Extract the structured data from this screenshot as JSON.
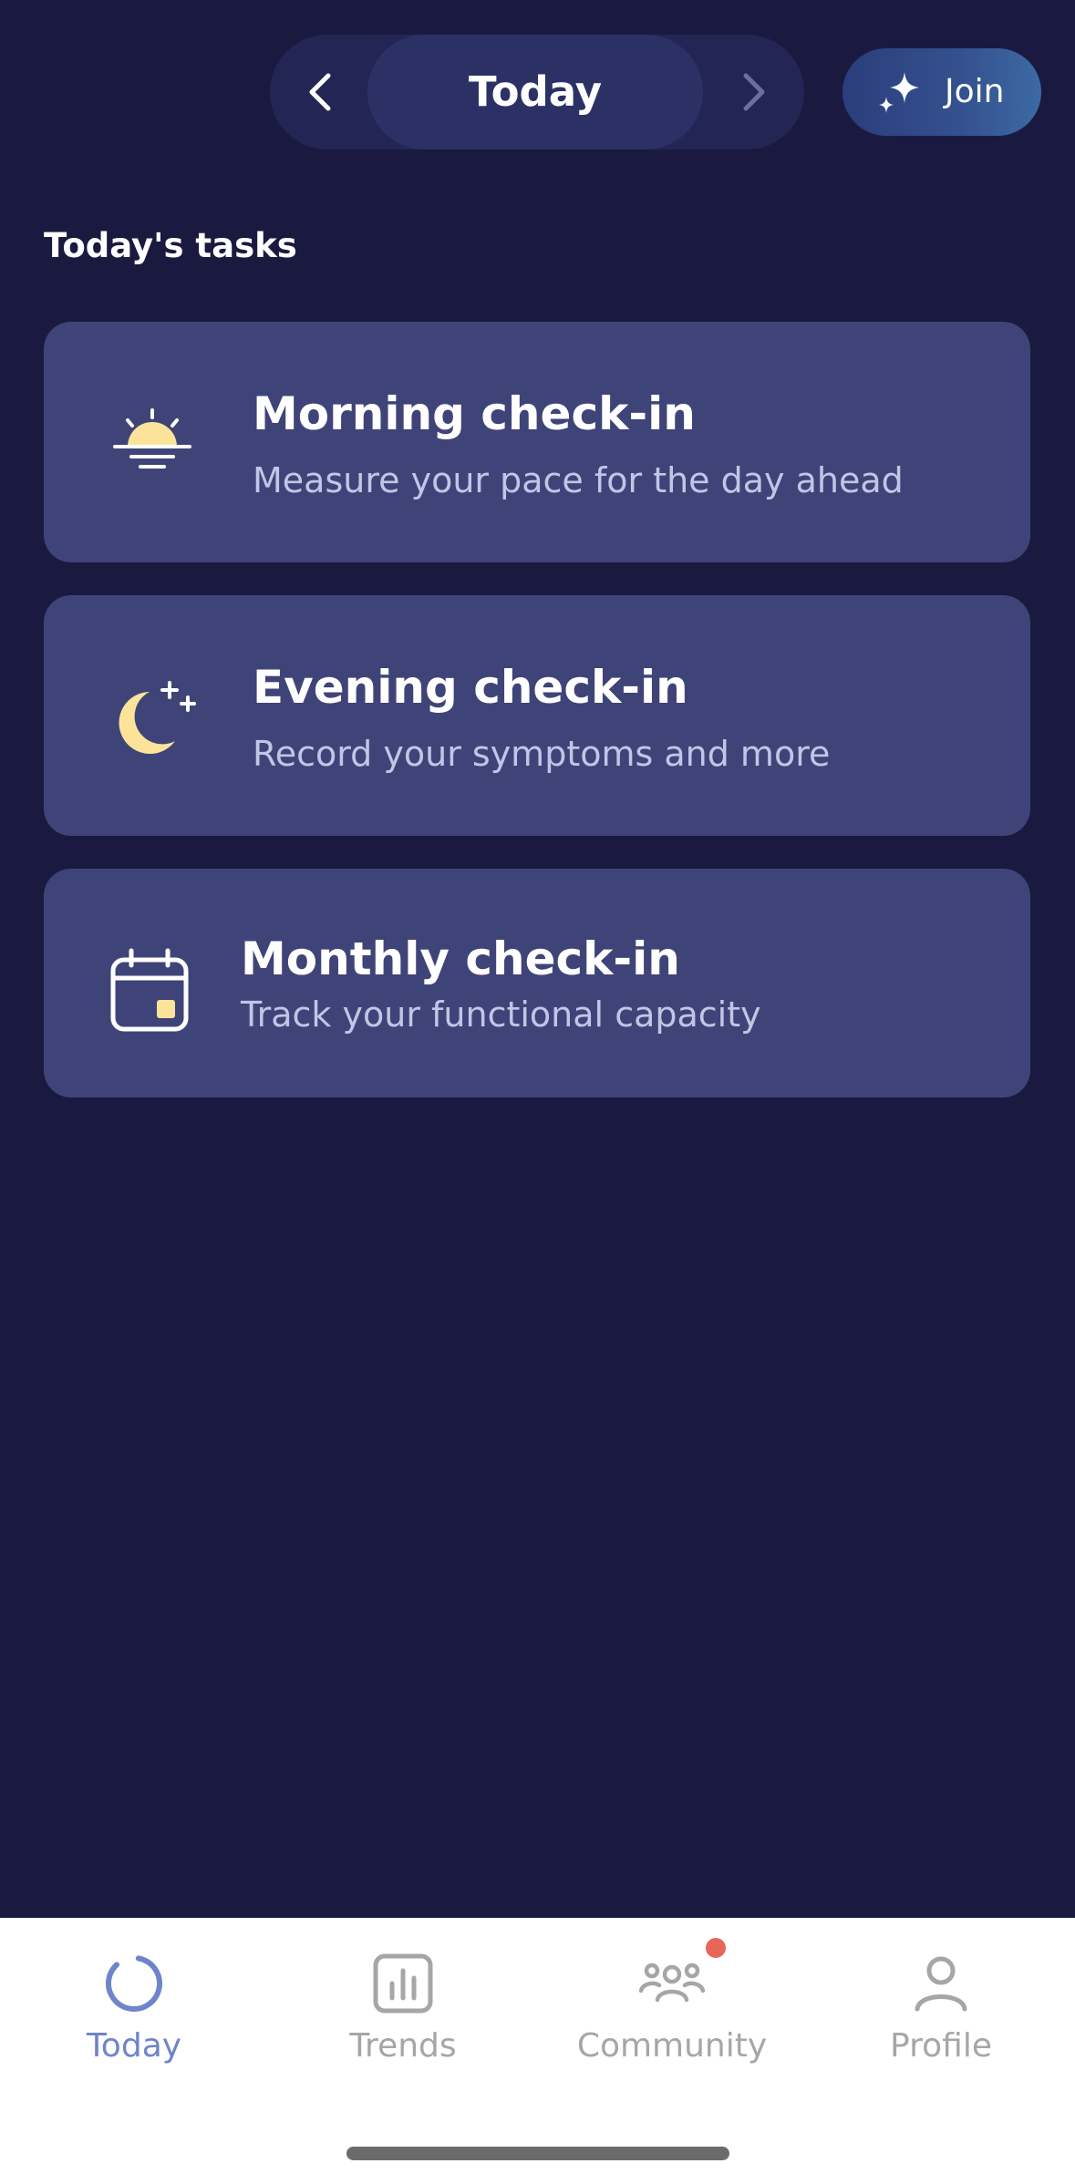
{
  "header": {
    "date_label": "Today",
    "join_label": "Join"
  },
  "section_title": "Today's tasks",
  "tasks": [
    {
      "title": "Morning check-in",
      "subtitle": "Measure your pace for the day ahead",
      "icon": "sunrise-icon"
    },
    {
      "title": "Evening check-in",
      "subtitle": "Record your symptoms and more",
      "icon": "moon-stars-icon"
    },
    {
      "title": "Monthly check-in",
      "subtitle": "Track your functional capacity",
      "icon": "calendar-icon"
    }
  ],
  "tabs": [
    {
      "label": "Today",
      "icon": "progress-circle-icon",
      "active": true
    },
    {
      "label": "Trends",
      "icon": "bar-chart-icon",
      "active": false
    },
    {
      "label": "Community",
      "icon": "people-icon",
      "active": false,
      "badge": true
    },
    {
      "label": "Profile",
      "icon": "person-icon",
      "active": false
    }
  ],
  "colors": {
    "background": "#1a1a40",
    "card": "#3f4478",
    "accent_yellow": "#fbe49a",
    "active_tab": "#6f84c9",
    "inactive_tab": "#a6a6a6",
    "badge": "#e8655a"
  }
}
